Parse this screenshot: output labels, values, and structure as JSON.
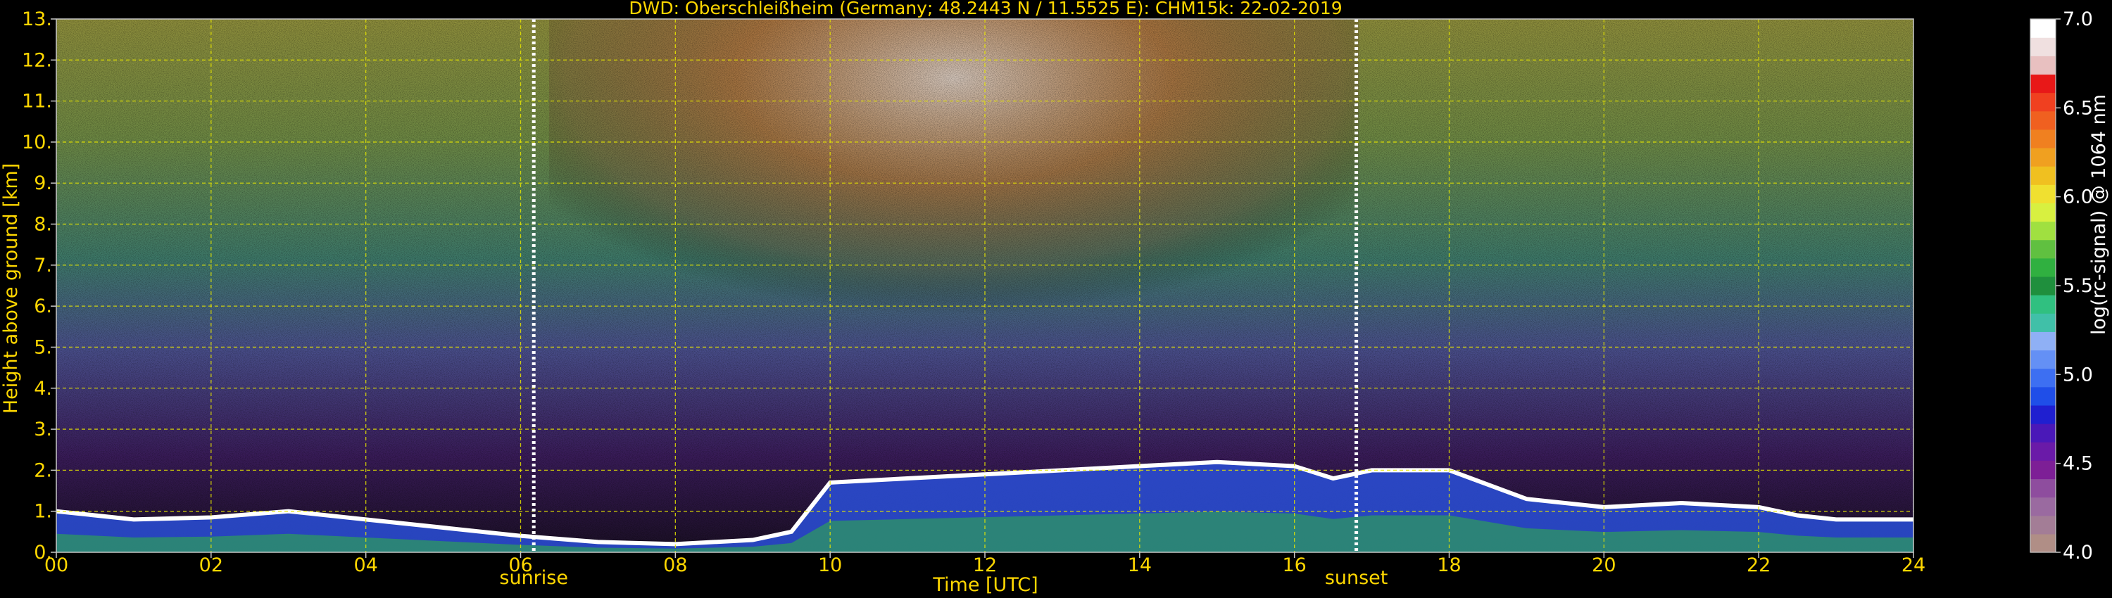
{
  "chart_data": {
    "type": "heatmap",
    "title": "DWD: Oberschleißheim (Germany; 48.2443 N / 11.5525 E):    CHM15k: 22-02-2019",
    "xlabel": "Time [UTC]",
    "ylabel": "Height above ground [km]",
    "xlim": [
      0,
      24
    ],
    "ylim": [
      0,
      13
    ],
    "x_ticks": [
      "00",
      "02",
      "04",
      "06",
      "08",
      "10",
      "12",
      "14",
      "16",
      "18",
      "20",
      "22",
      "24"
    ],
    "y_ticks": [
      "0.",
      "1.",
      "2.",
      "3.",
      "4.",
      "5.",
      "6.",
      "7.",
      "8.",
      "9.",
      "10.",
      "11.",
      "12.",
      "13."
    ],
    "grid": true,
    "colorbar": {
      "label": "log(rc-signal) @ 1064 nm",
      "range": [
        4.0,
        7.0
      ],
      "ticks": [
        "4.0",
        "4.5",
        "5.0",
        "5.5",
        "6.0",
        "6.5",
        "7.0"
      ],
      "colors": [
        "#b08e86",
        "#a37d96",
        "#9a6aa0",
        "#8e4d9e",
        "#7d1f96",
        "#6a1aa8",
        "#4a18b8",
        "#1f1fd0",
        "#1f4ee8",
        "#3d6ff2",
        "#6490f5",
        "#8fb0f5",
        "#40c0a8",
        "#30c080",
        "#1f8f3d",
        "#30b040",
        "#60c040",
        "#a0e040",
        "#d8f040",
        "#f0e030",
        "#f0c020",
        "#f0a020",
        "#f08020",
        "#f06020",
        "#f04020",
        "#e81818",
        "#e8c0c0",
        "#f0e0e0",
        "#ffffff"
      ]
    },
    "markers": [
      {
        "label": "sunrise",
        "x": 6.17
      },
      {
        "label": "sunset",
        "x": 16.8
      }
    ],
    "boundary_layer_top_km": [
      [
        0.0,
        1.0
      ],
      [
        1.0,
        0.8
      ],
      [
        2.0,
        0.85
      ],
      [
        3.0,
        1.0
      ],
      [
        4.0,
        0.8
      ],
      [
        5.0,
        0.6
      ],
      [
        6.0,
        0.4
      ],
      [
        7.0,
        0.25
      ],
      [
        8.0,
        0.2
      ],
      [
        9.0,
        0.3
      ],
      [
        9.5,
        0.5
      ],
      [
        10.0,
        1.7
      ],
      [
        11.0,
        1.8
      ],
      [
        12.0,
        1.9
      ],
      [
        13.0,
        2.0
      ],
      [
        14.0,
        2.1
      ],
      [
        15.0,
        2.2
      ],
      [
        16.0,
        2.1
      ],
      [
        16.5,
        1.8
      ],
      [
        17.0,
        2.0
      ],
      [
        18.0,
        2.0
      ],
      [
        19.0,
        1.3
      ],
      [
        20.0,
        1.1
      ],
      [
        21.0,
        1.2
      ],
      [
        22.0,
        1.1
      ],
      [
        22.5,
        0.9
      ],
      [
        23.0,
        0.8
      ],
      [
        24.0,
        0.8
      ]
    ]
  }
}
